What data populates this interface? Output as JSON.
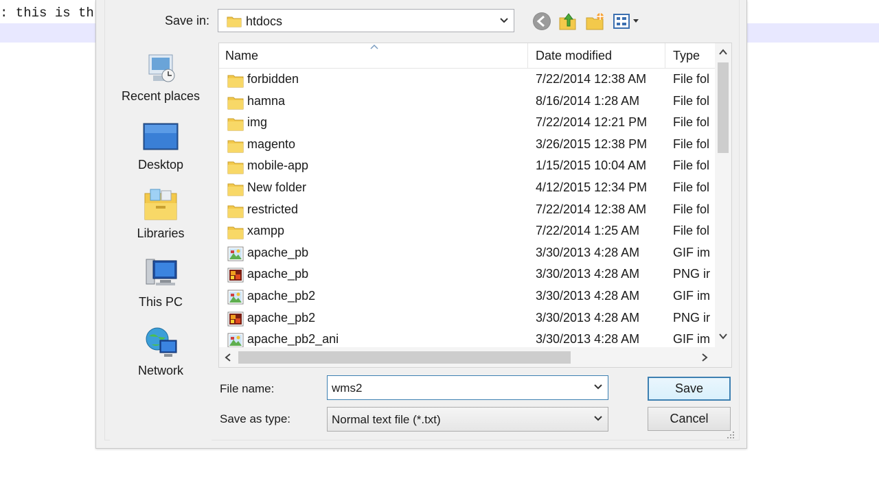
{
  "editor": {
    "text": ": this is th"
  },
  "dialog": {
    "save_in_label": "Save in:",
    "save_in_value": "htdocs",
    "toolbar": {
      "back": "back-icon",
      "up": "up-folder-icon",
      "new_folder": "new-folder-icon",
      "views": "views-menu-icon"
    },
    "places": [
      {
        "label": "Recent places",
        "icon": "recent-places-icon"
      },
      {
        "label": "Desktop",
        "icon": "desktop-icon"
      },
      {
        "label": "Libraries",
        "icon": "libraries-icon"
      },
      {
        "label": "This PC",
        "icon": "this-pc-icon"
      },
      {
        "label": "Network",
        "icon": "network-icon"
      }
    ],
    "columns": {
      "name": "Name",
      "date": "Date modified",
      "type": "Type"
    },
    "files": [
      {
        "name": "forbidden",
        "date": "7/22/2014 12:38 AM",
        "type": "File fol",
        "kind": "folder"
      },
      {
        "name": "hamna",
        "date": "8/16/2014 1:28 AM",
        "type": "File fol",
        "kind": "folder"
      },
      {
        "name": "img",
        "date": "7/22/2014 12:21 PM",
        "type": "File fol",
        "kind": "folder"
      },
      {
        "name": "magento",
        "date": "3/26/2015 12:38 PM",
        "type": "File fol",
        "kind": "folder"
      },
      {
        "name": "mobile-app",
        "date": "1/15/2015 10:04 AM",
        "type": "File fol",
        "kind": "folder"
      },
      {
        "name": "New folder",
        "date": "4/12/2015 12:34 PM",
        "type": "File fol",
        "kind": "folder"
      },
      {
        "name": "restricted",
        "date": "7/22/2014 12:38 AM",
        "type": "File fol",
        "kind": "folder"
      },
      {
        "name": "xampp",
        "date": "7/22/2014 1:25 AM",
        "type": "File fol",
        "kind": "folder"
      },
      {
        "name": "apache_pb",
        "date": "3/30/2013 4:28 AM",
        "type": "GIF im",
        "kind": "gif"
      },
      {
        "name": "apache_pb",
        "date": "3/30/2013 4:28 AM",
        "type": "PNG ir",
        "kind": "png"
      },
      {
        "name": "apache_pb2",
        "date": "3/30/2013 4:28 AM",
        "type": "GIF im",
        "kind": "gif"
      },
      {
        "name": "apache_pb2",
        "date": "3/30/2013 4:28 AM",
        "type": "PNG ir",
        "kind": "png"
      },
      {
        "name": "apache_pb2_ani",
        "date": "3/30/2013 4:28 AM",
        "type": "GIF im",
        "kind": "gif"
      }
    ],
    "file_name_label": "File name:",
    "file_name_value": "wms2",
    "save_as_type_label": "Save as type:",
    "save_as_type_value": "Normal text file (*.txt)",
    "save_button": "Save",
    "cancel_button": "Cancel",
    "colors": {
      "accent": "#3c7fb1",
      "dialog_bg": "#f0f0f0",
      "folder": "#f3c94b"
    }
  }
}
